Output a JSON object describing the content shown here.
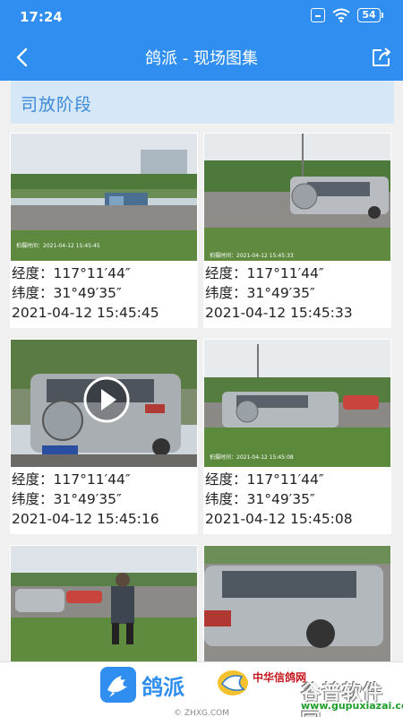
{
  "status": {
    "time": "17:24",
    "battery": "54"
  },
  "appbar": {
    "title": "鸽派 - 现场图集"
  },
  "section": {
    "title": "司放阶段"
  },
  "photos": [
    {
      "lng_label": "经度：",
      "lng": "117°11′44″",
      "lat_label": "纬度：",
      "lat": "31°49′35″",
      "datetime": "2021-04-12 15:45:45",
      "stamp": "拍摄时间：2021-04-12 15:45:45",
      "is_video": false
    },
    {
      "lng_label": "经度：",
      "lng": "117°11′44″",
      "lat_label": "纬度：",
      "lat": "31°49′35″",
      "datetime": "2021-04-12 15:45:33",
      "stamp": "拍摄时间：2021-04-12 15:45:33",
      "is_video": false
    },
    {
      "lng_label": "经度：",
      "lng": "117°11′44″",
      "lat_label": "纬度：",
      "lat": "31°49′35″",
      "datetime": "2021-04-12 15:45:16",
      "stamp": "",
      "is_video": true
    },
    {
      "lng_label": "经度：",
      "lng": "117°11′44″",
      "lat_label": "纬度：",
      "lat": "31°49′35″",
      "datetime": "2021-04-12 15:45:08",
      "stamp": "拍摄时间：2021-04-12 15:45:08",
      "is_video": false
    },
    {
      "is_video": false
    },
    {
      "is_video": false
    }
  ],
  "bottom": {
    "brand": "鸽派",
    "watermark_cn": "中华信鸽网",
    "watermark_site": "谷普软件园",
    "watermark_url": "www.gupuxiazai.com",
    "footer": "© ZHXG.COM"
  },
  "colors": {
    "primary": "#2f8ef0",
    "section_bg": "#d6e7f8",
    "section_text": "#3b8ad8"
  }
}
